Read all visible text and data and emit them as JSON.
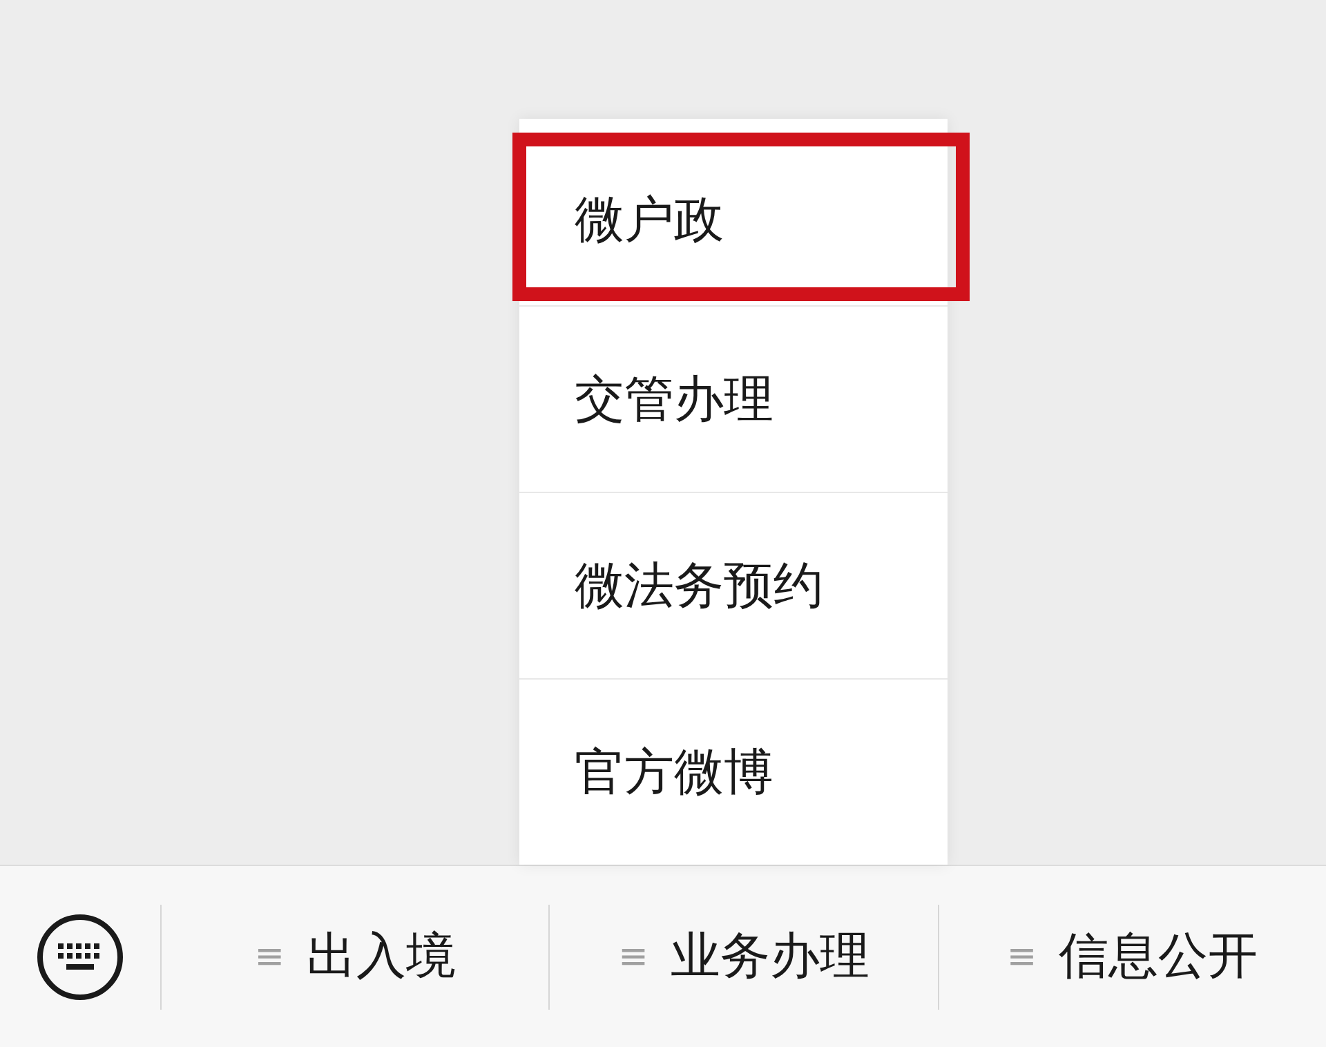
{
  "popup_menu": {
    "items": [
      {
        "label": "微户政",
        "highlighted": true
      },
      {
        "label": "交管办理",
        "highlighted": false
      },
      {
        "label": "微法务预约",
        "highlighted": false
      },
      {
        "label": "官方微博",
        "highlighted": false
      }
    ]
  },
  "bottom_bar": {
    "menus": [
      {
        "icon": "≡",
        "label": "出入境"
      },
      {
        "icon": "≡",
        "label": "业务办理"
      },
      {
        "icon": "≡",
        "label": "信息公开"
      }
    ]
  }
}
